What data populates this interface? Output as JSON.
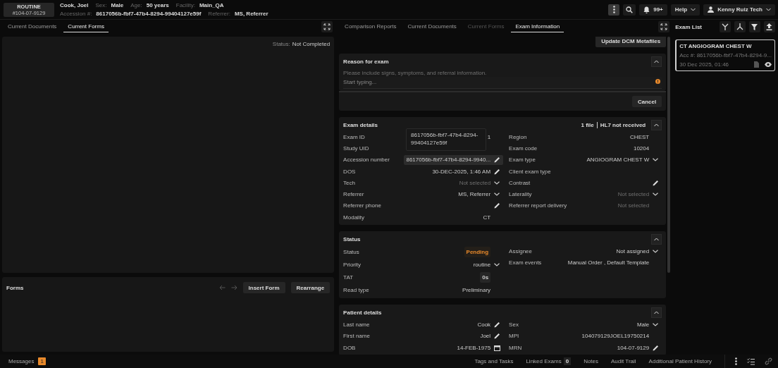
{
  "header": {
    "priority": "ROUTINE",
    "mrn": "#104-07-9129",
    "patient_name": "Cook, Joel",
    "line1": [
      {
        "label": "Sex:",
        "value": "Male"
      },
      {
        "label": "Age:",
        "value": "50 years"
      },
      {
        "label": "Facility:",
        "value": "Main_QA"
      }
    ],
    "line2": [
      {
        "label": "Accession #:",
        "value": "8617056b-fbf7-47b4-8294-99404127e59f"
      },
      {
        "label": "Referrer:",
        "value": "MS, Referrer"
      }
    ],
    "notifications": "99+",
    "help": "Help",
    "user": "Kenny Ruiz Tech"
  },
  "left_tabs": [
    {
      "label": "Current Documents",
      "selected": false
    },
    {
      "label": "Current Forms",
      "selected": true
    }
  ],
  "form_status": {
    "label": "Status:",
    "value": "Not Completed"
  },
  "forms": {
    "title": "Forms",
    "buttons": [
      "Insert Form",
      "Rearrange"
    ]
  },
  "middle_tabs": [
    {
      "label": "Comparison Reports",
      "selected": false,
      "disabled": false
    },
    {
      "label": "Current Documents",
      "selected": false,
      "disabled": false
    },
    {
      "label": "Current Forms",
      "selected": false,
      "disabled": true
    },
    {
      "label": "Exam Information",
      "selected": true,
      "disabled": false
    }
  ],
  "update_button": "Update DCM Metafiles",
  "reason": {
    "title": "Reason for exam",
    "hint": "Please include signs, symptoms, and referral information.",
    "placeholder": "Start typing...",
    "cancel": "Cancel"
  },
  "exam_details": {
    "title": "Exam details",
    "files": "1 file",
    "hl7": "HL7 not received",
    "tooltip": "8617056b-fbf7-47b4-8294-99404127e59f",
    "left": [
      {
        "label": "Exam ID",
        "value": "1",
        "kind": "text",
        "hovered": false
      },
      {
        "label": "Study UID",
        "kind": "text",
        "hovered": false
      },
      {
        "label": "Accession number",
        "value": "8617056b-fbf7-47b4-8294-9940...",
        "kind": "edit",
        "hovered": true
      },
      {
        "label": "DOS",
        "value": "30-DEC-2025, 1:46 AM",
        "kind": "edit",
        "hovered": false
      },
      {
        "label": "Tech",
        "placeholder": "Not selected",
        "kind": "dropdown",
        "hovered": false
      },
      {
        "label": "Referrer",
        "value": "MS, Referrer",
        "kind": "dropdown",
        "hovered": false
      },
      {
        "label": "Referrer phone",
        "kind": "edit",
        "hovered": false
      },
      {
        "label": "Modality",
        "value": "CT",
        "kind": "text",
        "hovered": false
      }
    ],
    "right": [
      {
        "label": "Region",
        "value": "CHEST",
        "kind": "text",
        "hovered": false
      },
      {
        "label": "Exam code",
        "value": "10204",
        "kind": "text",
        "hovered": false
      },
      {
        "label": "Exam type",
        "value": "ANGIOGRAM CHEST W",
        "kind": "dropdown",
        "hovered": false
      },
      {
        "label": "Client exam type",
        "kind": "text",
        "hovered": false
      },
      {
        "label": "Contrast",
        "kind": "edit",
        "hovered": false
      },
      {
        "label": "Laterality",
        "placeholder": "Not selected",
        "kind": "dropdown",
        "hovered": false
      },
      {
        "label": "Referrer report delivery",
        "placeholder": "Not selected",
        "kind": "text",
        "hovered": false
      }
    ]
  },
  "status": {
    "title": "Status",
    "left": [
      {
        "label": "Status",
        "value": "Pending",
        "kind": "status"
      },
      {
        "label": "Priority",
        "value": "routine",
        "kind": "dropdown"
      },
      {
        "label": "TAT",
        "value": "0s",
        "kind": "chip"
      },
      {
        "label": "Read type",
        "value": "Preliminary",
        "kind": "text"
      }
    ],
    "right": [
      {
        "label": "Assignee",
        "value": "Not assigned",
        "kind": "dropdown"
      },
      {
        "label": "Exam events",
        "value": "Manual Order , Default Template",
        "kind": "text"
      }
    ]
  },
  "patient": {
    "title": "Patient details",
    "left": [
      {
        "label": "Last name",
        "value": "Cook",
        "kind": "edit"
      },
      {
        "label": "First name",
        "value": "Joel",
        "kind": "edit"
      },
      {
        "label": "DOB",
        "value": "14-FEB-1975",
        "kind": "calendar"
      }
    ],
    "right": [
      {
        "label": "Sex",
        "value": "Male",
        "kind": "dropdown"
      },
      {
        "label": "MPI",
        "value": "104079129JOEL19750214",
        "kind": "text"
      },
      {
        "label": "MRN",
        "value": "104-07-9129",
        "kind": "edit"
      }
    ]
  },
  "exam_list": {
    "title": "Exam List",
    "exams": [
      {
        "title": "CT ANGIOGRAM CHEST W",
        "accession": "Acc #: 8617056b-fbf7-47b4-8294-9...",
        "date": "30 Dec 2025, 01:46",
        "selected": true
      }
    ]
  },
  "bottom": {
    "messages": "Messages",
    "message_count": "1",
    "tabs": [
      {
        "label": "Tags and Tasks"
      },
      {
        "label": "Linked Exams",
        "count": "0"
      },
      {
        "label": "Notes"
      },
      {
        "label": "Audit Trail"
      },
      {
        "label": "Additional Patient History"
      }
    ]
  }
}
